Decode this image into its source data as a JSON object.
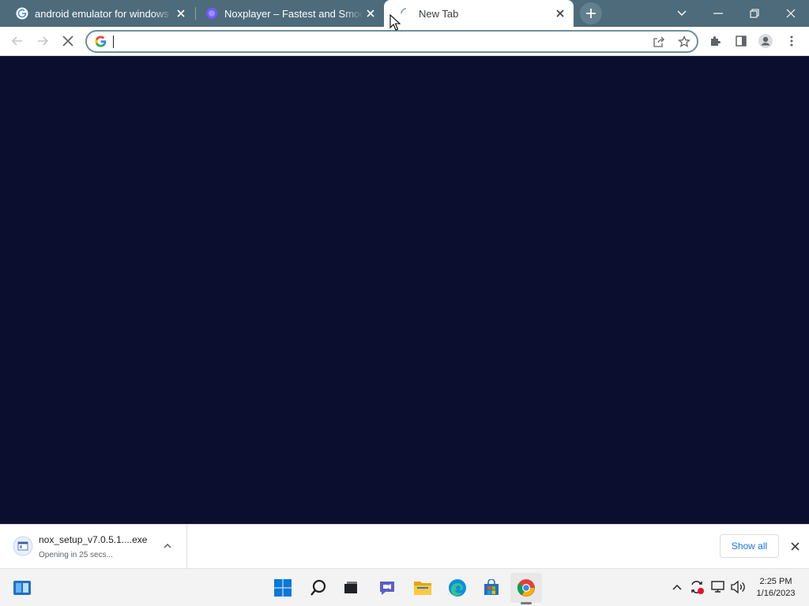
{
  "browser": {
    "tabs": [
      {
        "title": "android emulator for windows - G",
        "favicon": "google-g-icon"
      },
      {
        "title": "Noxplayer – Fastest and Smoothest",
        "favicon": "nox-icon"
      },
      {
        "title": "New Tab",
        "favicon": "loading-spinner-icon",
        "active": true
      }
    ],
    "omnibox": {
      "value": "",
      "placeholder": ""
    }
  },
  "downloads": {
    "file_name": "nox_setup_v7.0.5.1....exe",
    "status": "Opening in 25 secs...",
    "show_all_label": "Show all"
  },
  "taskbar": {
    "time": "2:25 PM",
    "date": "1/16/2023"
  },
  "colors": {
    "tabstrip": "#4d6b7a",
    "page_background": "#0b0e2e",
    "accent_blue": "#1a73e8"
  }
}
